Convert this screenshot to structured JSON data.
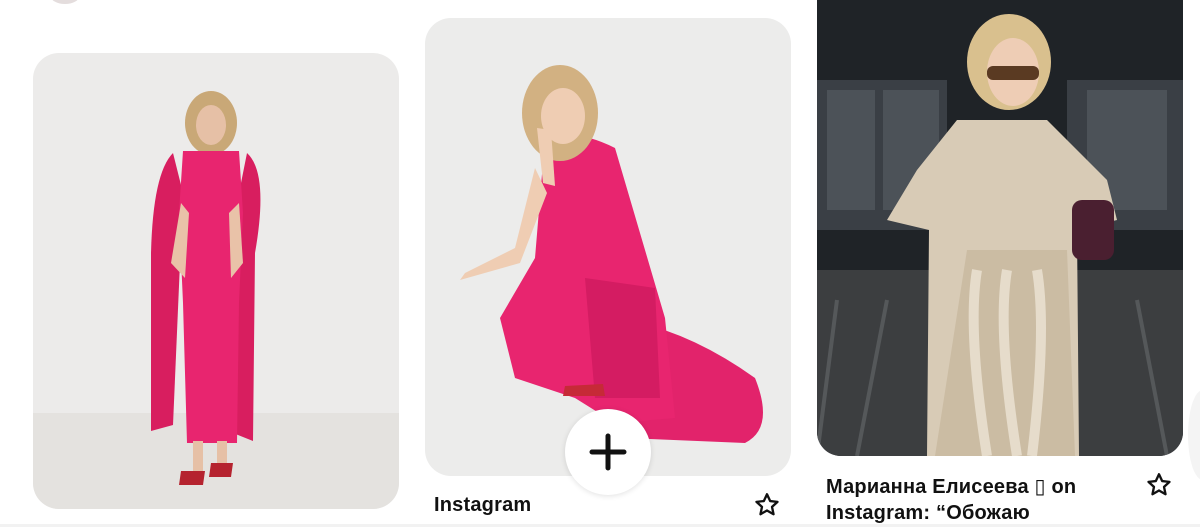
{
  "pins": [
    {
      "id": "pin-1",
      "image": "woman in pink cape dress, studio",
      "title": ""
    },
    {
      "id": "pin-2",
      "image": "woman crouching in pink cape dress, studio",
      "title": "Instagram"
    },
    {
      "id": "pin-3",
      "image": "woman in beige ruffled trench coat, street",
      "title": "Марианна Елисеева ▯ on Instagram: “Обожаю"
    }
  ],
  "actions": {
    "add_icon": "plus-icon",
    "save_icon": "star-outline-icon"
  },
  "colors": {
    "accent_pink": "#e8256f",
    "text": "#111111",
    "background": "#ffffff"
  }
}
